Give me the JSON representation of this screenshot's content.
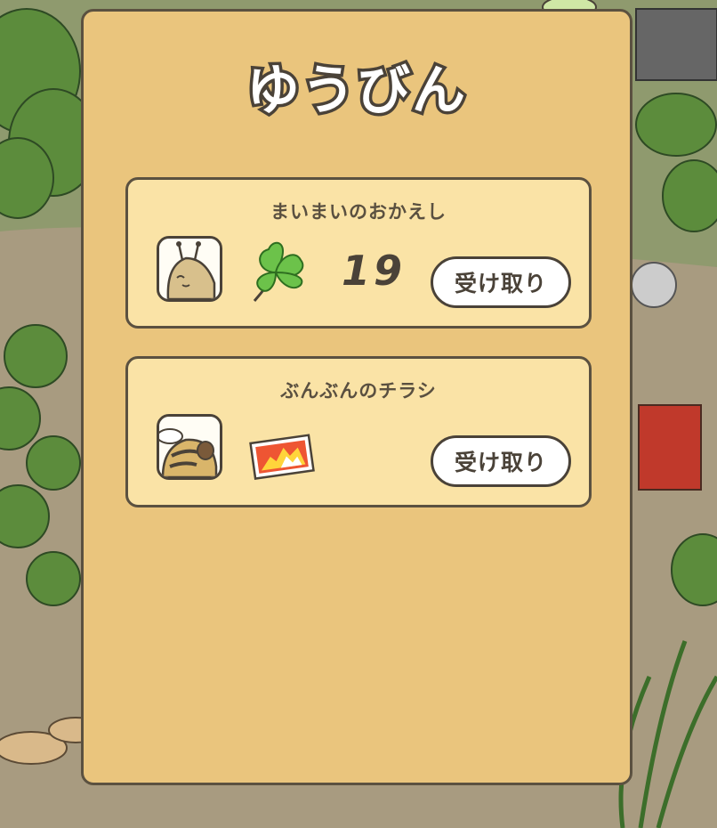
{
  "screen": {
    "title": "ゆうびん"
  },
  "mail": [
    {
      "sender": "まいまいのおかえし",
      "sender_icon": "snail-face-icon",
      "reward_icon": "clover-icon",
      "count": "19",
      "button_label": "受け取り"
    },
    {
      "sender": "ぶんぶんのチラシ",
      "sender_icon": "bee-face-icon",
      "reward_icon": "flyer-ticket-icon",
      "button_label": "受け取り"
    }
  ],
  "colors": {
    "panel": "#eac57d",
    "card": "#fae3a6",
    "outline": "#4a4238",
    "clover": "#6cc24a",
    "flyer": "#ee5533"
  }
}
